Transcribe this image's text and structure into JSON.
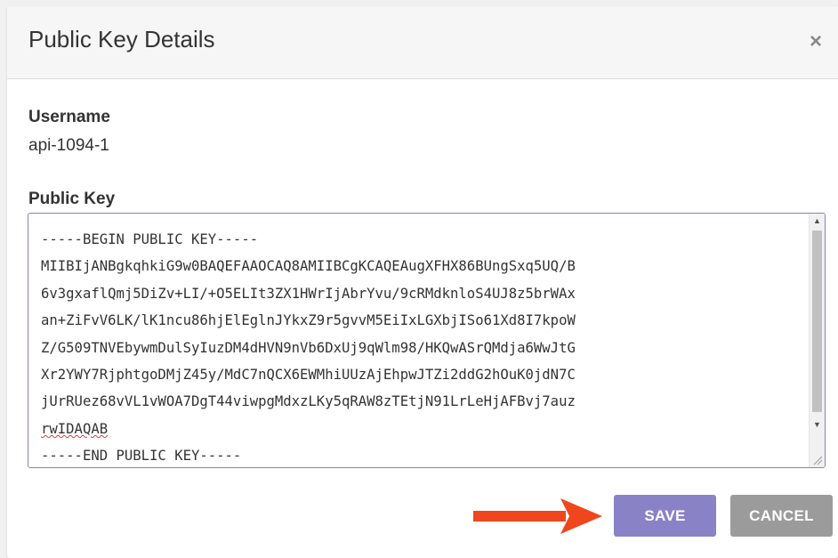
{
  "dialog": {
    "title": "Public Key Details",
    "close_glyph": "×"
  },
  "username": {
    "label": "Username",
    "value": "api-1094-1"
  },
  "public_key": {
    "label": "Public Key",
    "lines": [
      "-----BEGIN PUBLIC KEY-----",
      "MIIBIjANBgkqhkiG9w0BAQEFAAOCAQ8AMIIBCgKCAQEAugXFHX86BUngSxq5UQ/B",
      "6v3gxaflQmj5DiZv+LI/+O5ELIt3ZX1HWrIjAbrYvu/9cRMdknloS4UJ8z5brWAx",
      "an+ZiFvV6LK/lK1ncu86hjElEglnJYkxZ9r5gvvM5EiIxLGXbjISo61Xd8I7kpoW",
      "Z/G509TNVEbywmDulSyIuzDM4dHVN9nVb6DxUj9qWlm98/HKQwASrQMdja6WwJtG",
      "Xr2YWY7RjphtgoDMjZ45y/MdC7nQCX6EWMhiUUzAjEhpwJTZi2ddG2hOuK0jdN7C",
      "jUrRUez68vVL1vWOA7DgT44viwpgMdxzLKy5qRAW8zTEtjN91LrLeHjAFBvj7auz",
      "rwIDAQAB",
      "-----END PUBLIC KEY-----"
    ]
  },
  "buttons": {
    "save": "SAVE",
    "cancel": "CANCEL"
  },
  "icons": {
    "close": "close-icon",
    "arrow": "arrow-right-icon",
    "scroll_up": "scroll-up-icon",
    "scroll_down": "scroll-down-icon",
    "resize": "resize-handle-icon"
  },
  "colors": {
    "save_bg": "#8a82c6",
    "cancel_bg": "#9b9b9b",
    "arrow": "#f0461e",
    "textarea_border": "#8c7fc0"
  }
}
